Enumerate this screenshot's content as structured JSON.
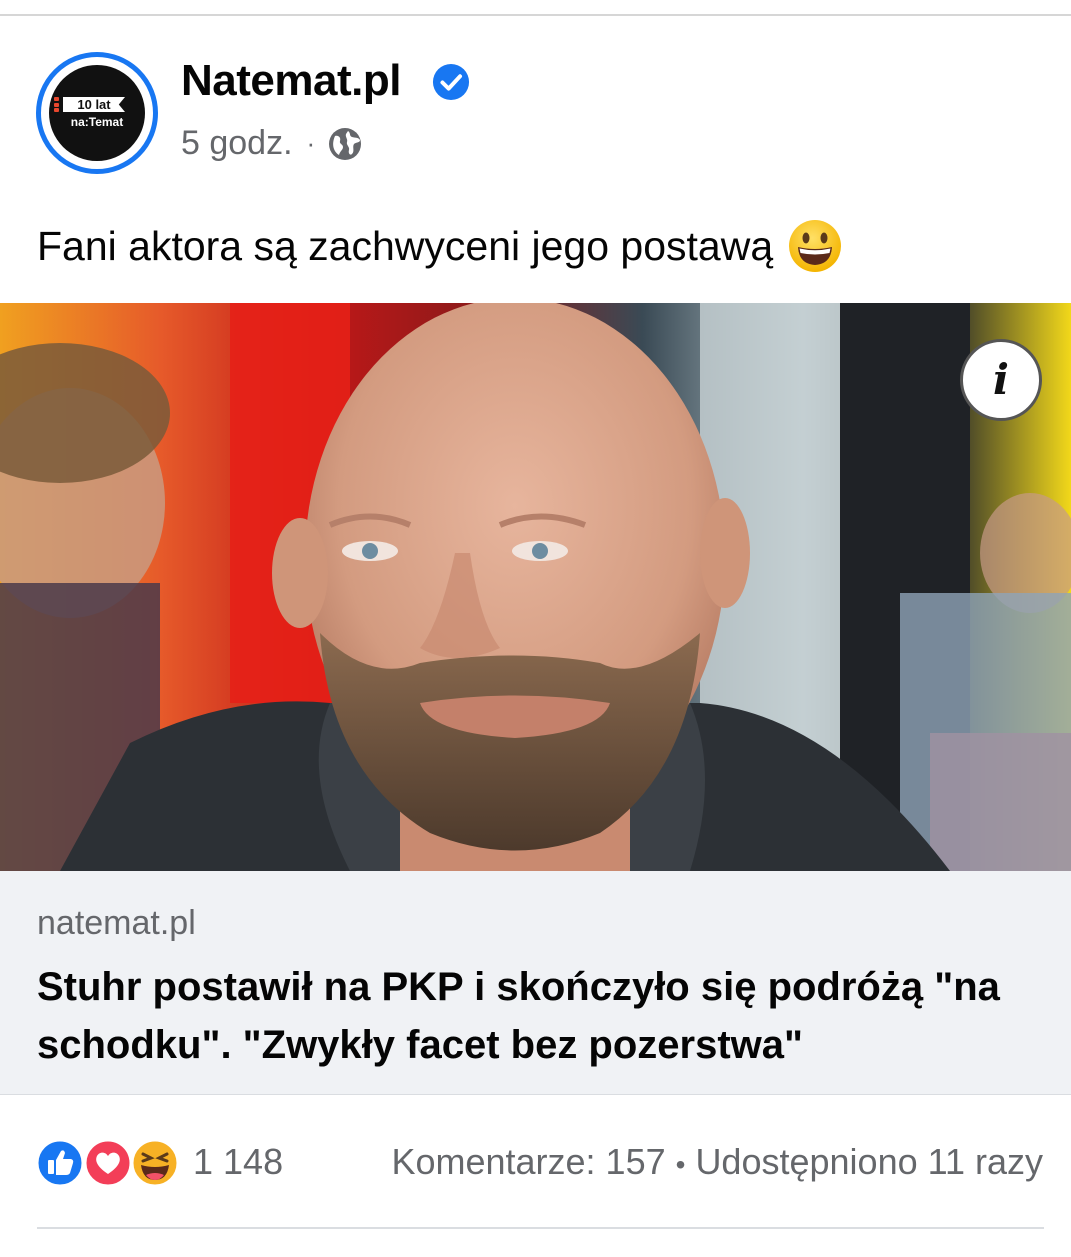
{
  "post": {
    "page_name": "Natemat.pl",
    "time": "5 godz.",
    "separator": "·",
    "caption": "Fani aktora są zachwyceni jego postawą",
    "avatar": {
      "badge_text": "10 lat",
      "sub_text": "na:Temat"
    },
    "icons": {
      "verified": "verified-badge-icon",
      "audience": "globe-icon",
      "caption_emoji": "grinning-face-icon",
      "info": "info-icon"
    },
    "photo_info_label": "i"
  },
  "link_preview": {
    "domain": "natemat.pl",
    "title": "Stuhr postawił na PKP i skończyło się podróżą \"na schodku\". \"Zwykły facet bez pozerstwa\""
  },
  "footer": {
    "reaction_icons": [
      "like-icon",
      "love-icon",
      "haha-icon"
    ],
    "reaction_count": "1 148",
    "comments": "Komentarze: 157",
    "separator": "•",
    "shares": "Udostępniono 11 razy"
  },
  "colors": {
    "brand_blue": "#1877f2",
    "secondary_text": "#65676b",
    "link_bg": "#f0f2f5"
  }
}
